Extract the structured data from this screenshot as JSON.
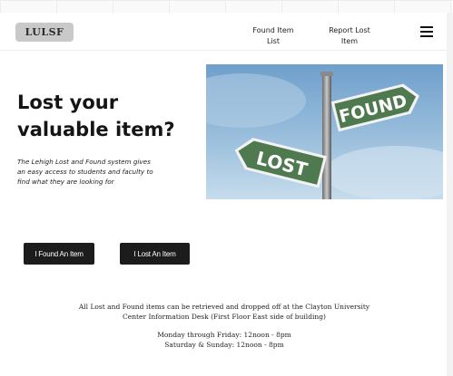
{
  "brand": {
    "logo_text": "LULSF"
  },
  "nav": {
    "found_item_list": [
      "Found Item",
      "List"
    ],
    "report_lost_item": [
      "Report Lost",
      "Item"
    ],
    "menu_icon": "hamburger-icon"
  },
  "hero": {
    "title": "Lost your valuable item?",
    "description": "The Lehigh Lost and Found system gives an easy access to students and faculty to find what they are looking for",
    "image": {
      "found_sign": "FOUND",
      "lost_sign": "LOST",
      "sky_color": "#8fb6d8",
      "sign_color": "#4f7a4f"
    }
  },
  "actions": {
    "found_button": "I Found An Item",
    "lost_button": "I Lost An Item"
  },
  "info": {
    "line1": "All Lost and Found items can be retrieved and dropped off at the Clayton University",
    "line2": "Center Information Desk (First Floor East side of building)",
    "hours_weekday": "Monday through Friday:  12noon - 8pm",
    "hours_weekend": "Saturday & Sunday: 12noon - 8pm"
  }
}
